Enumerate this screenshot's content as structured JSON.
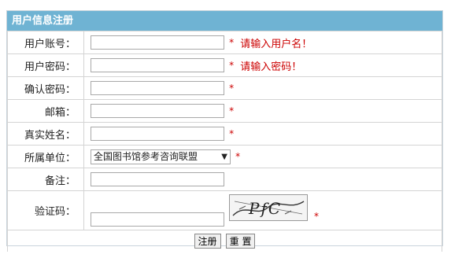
{
  "form": {
    "title": "用户信息注册",
    "fields": [
      {
        "label": "用户账号：",
        "value": "",
        "required": "*",
        "error": "请输入用户名！"
      },
      {
        "label": "用户密码：",
        "value": "",
        "required": "*",
        "error": "请输入密码！"
      },
      {
        "label": "确认密码：",
        "value": "",
        "required": "*"
      },
      {
        "label": "邮箱：",
        "value": "",
        "required": "*"
      },
      {
        "label": "真实姓名：",
        "value": "",
        "required": "*"
      }
    ],
    "unit": {
      "label": "所属单位：",
      "selected": "全国图书馆参考咨询联盟",
      "arrow": "▼",
      "required": "*"
    },
    "remark": {
      "label": "备注：",
      "value": ""
    },
    "captcha": {
      "label": "验证码：",
      "value": "",
      "image_text": "PfC",
      "required": "*"
    },
    "buttons": {
      "submit": "注册",
      "reset": "重 置"
    }
  },
  "colors": {
    "header_bg": "#6fb3d3",
    "error": "#cc0000",
    "border": "#d4d4d4"
  }
}
